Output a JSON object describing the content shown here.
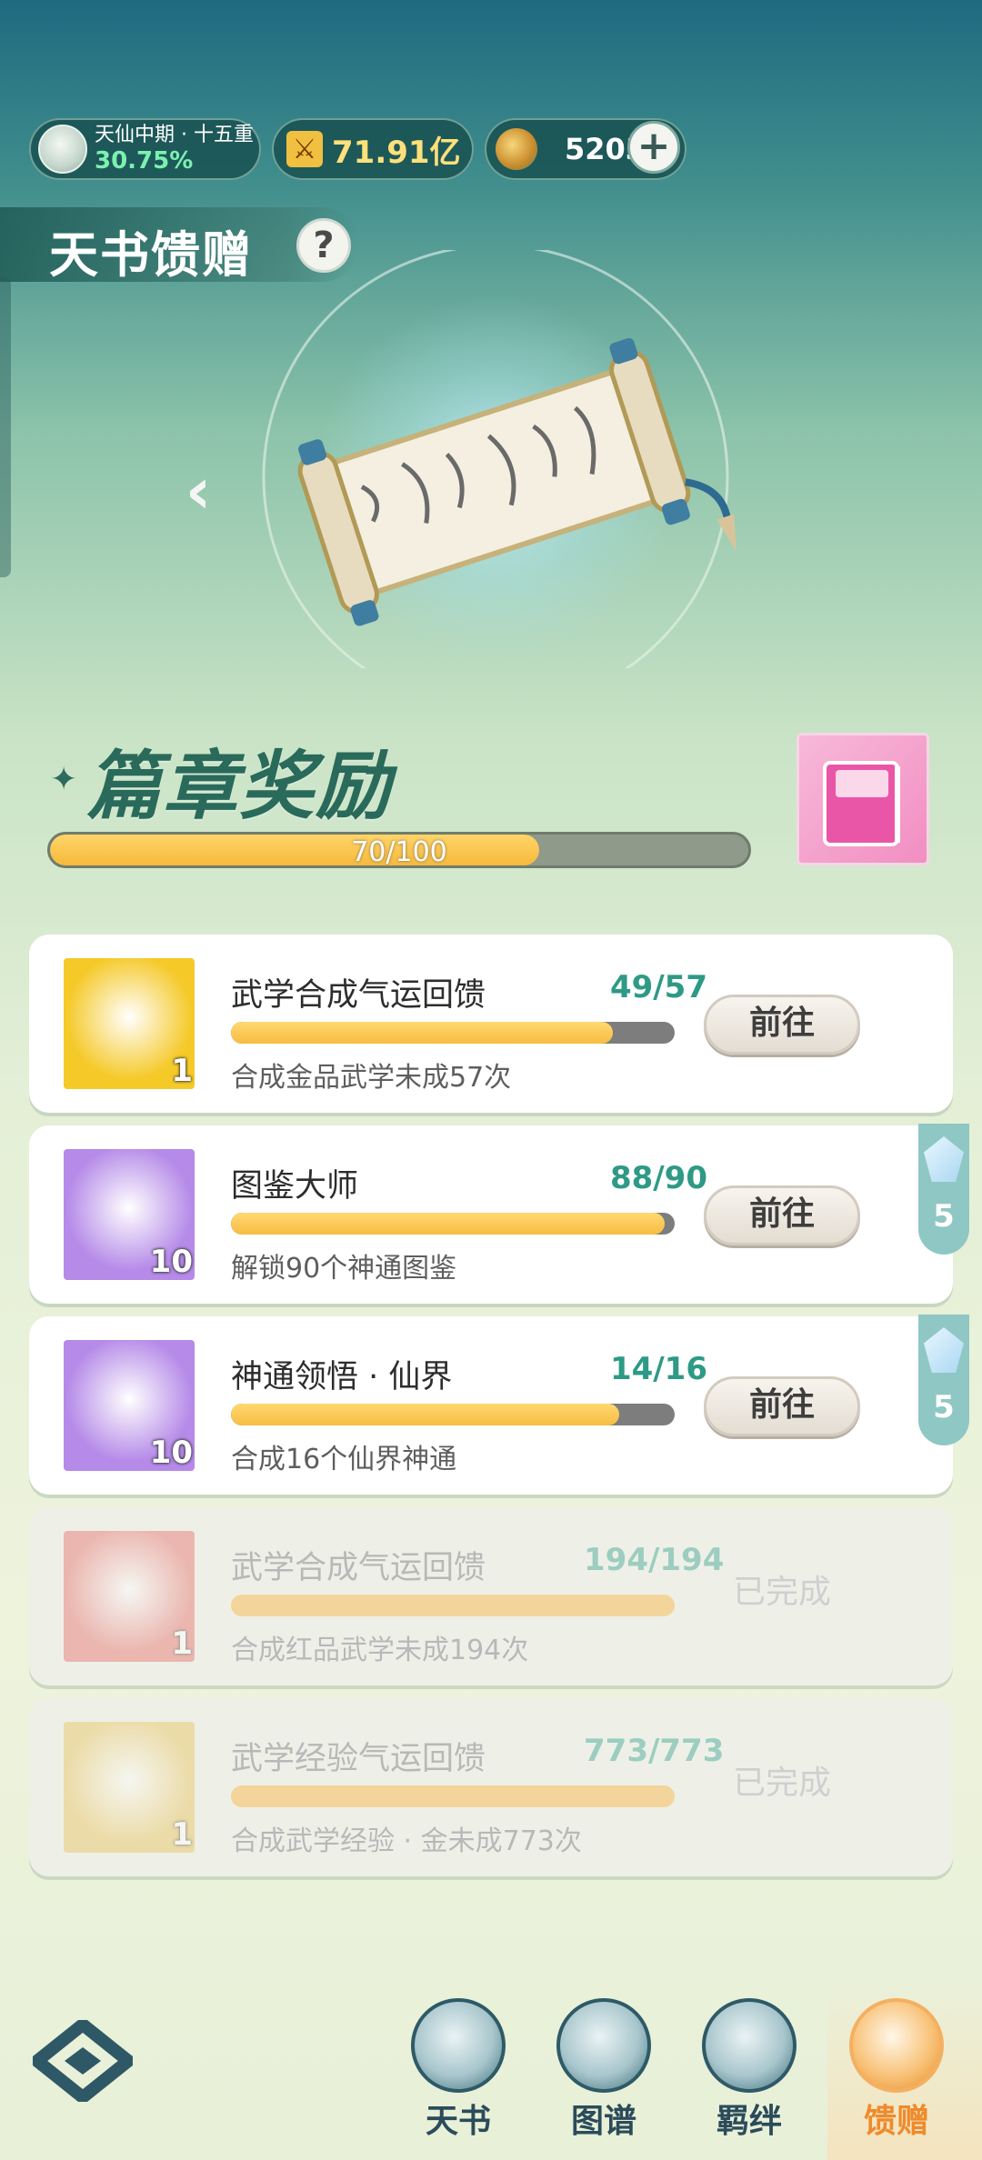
{
  "topbar": {
    "realm_name": "天仙中期 · 十五重",
    "realm_percent": "30.75%",
    "power_value": "71.91亿",
    "currency_value": "5203",
    "plus_label": "+"
  },
  "title": {
    "text": "天书馈赠",
    "help_label": "?"
  },
  "hero": {
    "prev_label": "‹"
  },
  "chapter": {
    "title": "篇章奖励",
    "star": "✦",
    "progress_text": "70/100",
    "progress_fraction": 0.7
  },
  "tasks": [
    {
      "name": "武学合成气运回馈",
      "progress": "49/57",
      "fraction": 0.86,
      "desc": "合成金品武学未成57次",
      "count": "1",
      "button": "前往",
      "side_count": "",
      "icon": "gold-book-icon",
      "icon_color": "#f5c928"
    },
    {
      "name": "图鉴大师",
      "progress": "88/90",
      "fraction": 0.978,
      "desc": "解锁90个神通图鉴",
      "count": "10",
      "button": "前往",
      "side_count": "5",
      "icon": "purple-orb-icon",
      "icon_color": "#b58ae8"
    },
    {
      "name": "神通领悟 · 仙界",
      "progress": "14/16",
      "fraction": 0.875,
      "desc": "合成16个仙界神通",
      "count": "10",
      "button": "前往",
      "side_count": "5",
      "icon": "purple-orb-icon",
      "icon_color": "#b58ae8"
    },
    {
      "name": "武学合成气运回馈",
      "progress": "194/194",
      "fraction": 1.0,
      "desc": "合成红品武学未成194次",
      "count": "1",
      "button": "已完成",
      "side_count": "",
      "icon": "red-book-icon",
      "icon_color": "#e6706a"
    },
    {
      "name": "武学经验气运回馈",
      "progress": "773/773",
      "fraction": 1.0,
      "desc": "合成武学经验 · 金未成773次",
      "count": "1",
      "button": "已完成",
      "side_count": "",
      "icon": "gold-figure-icon",
      "icon_color": "#e8c25a"
    }
  ],
  "nav": [
    {
      "label": "天书",
      "icon": "book-icon"
    },
    {
      "label": "图谱",
      "icon": "map-icon"
    },
    {
      "label": "羁绊",
      "icon": "handshake-icon"
    },
    {
      "label": "馈赠",
      "icon": "gift-bag-icon"
    }
  ],
  "colors": {
    "accent": "#2e9a86",
    "progress": "#f7bc42",
    "active_nav": "#f08a2a"
  }
}
